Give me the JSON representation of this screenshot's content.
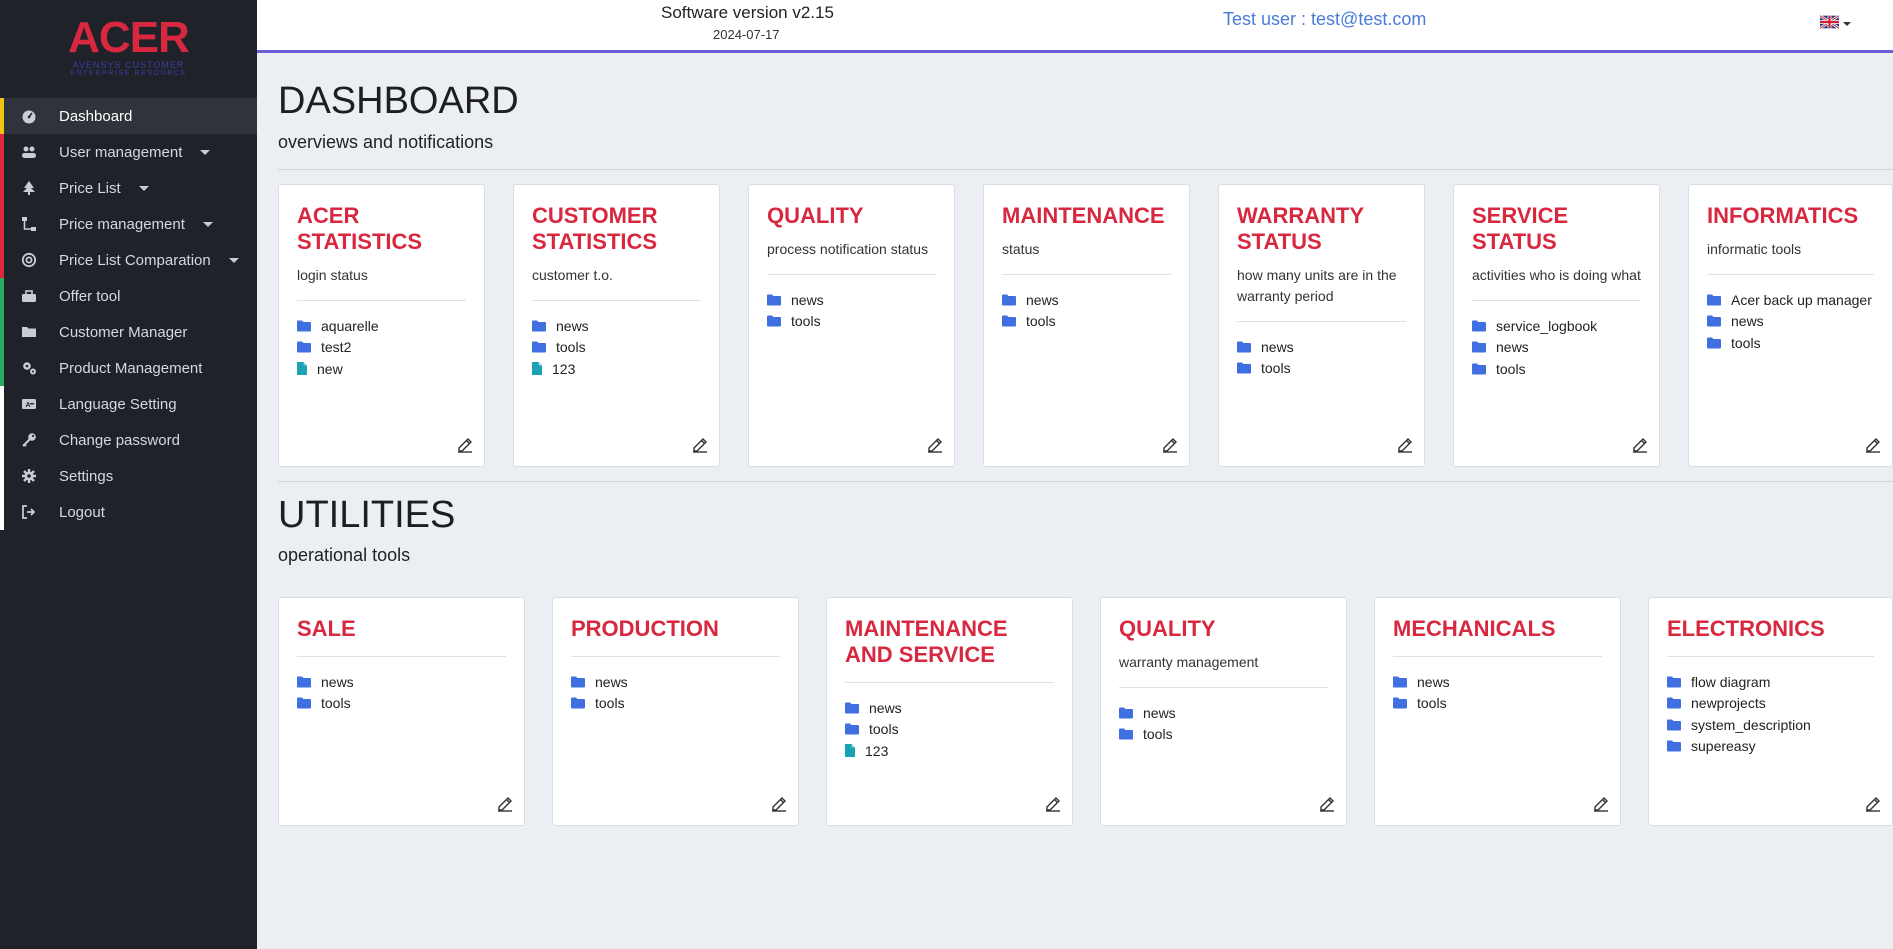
{
  "app": {
    "logo_main": "ACER",
    "logo_sub": "AVENSYS CUSTOMER",
    "logo_sub2": "ENTERPRISE RESOURCE"
  },
  "header": {
    "version": "Software version v2.15",
    "date": "2024-07-17",
    "user": "Test user : test@test.com",
    "language_icon": "uk-flag-icon"
  },
  "sidebar": {
    "items": [
      {
        "label": "Dashboard",
        "icon": "gauge-icon",
        "accent": "#f1c40f",
        "active": true
      },
      {
        "label": "User management",
        "icon": "users-icon",
        "accent": "#e0283f",
        "caret": true
      },
      {
        "label": "Price List",
        "icon": "tree-icon",
        "accent": "#e0283f",
        "caret": true
      },
      {
        "label": "Price management",
        "icon": "sitemap-icon",
        "accent": "#e0283f",
        "caret": true
      },
      {
        "label": "Price List Comparation",
        "icon": "target-icon",
        "accent": "#e0283f",
        "caret": true
      },
      {
        "label": "Offer tool",
        "icon": "toolbox-icon",
        "accent": "#27ae60"
      },
      {
        "label": "Customer Manager",
        "icon": "folder-icon",
        "accent": "#27ae60"
      },
      {
        "label": "Product Management",
        "icon": "cogs-icon",
        "accent": "#27ae60"
      },
      {
        "label": "Language Setting",
        "icon": "language-icon",
        "accent": "#ffffff"
      },
      {
        "label": "Change password",
        "icon": "key-icon",
        "accent": "#ffffff"
      },
      {
        "label": "Settings",
        "icon": "gear-icon",
        "accent": "#ffffff"
      },
      {
        "label": "Logout",
        "icon": "logout-icon",
        "accent": "#ffffff"
      }
    ]
  },
  "dashboard": {
    "title": "DASHBOARD",
    "subtitle": "overviews and notifications",
    "cards": [
      {
        "title": "ACER STATISTICS",
        "desc": "login status",
        "items": [
          {
            "label": "aquarelle",
            "type": "folder"
          },
          {
            "label": "test2",
            "type": "folder"
          },
          {
            "label": "new",
            "type": "file"
          }
        ]
      },
      {
        "title": "CUSTOMER STATISTICS",
        "desc": "customer t.o.",
        "items": [
          {
            "label": "news",
            "type": "folder"
          },
          {
            "label": "tools",
            "type": "folder"
          },
          {
            "label": "123",
            "type": "file"
          }
        ]
      },
      {
        "title": "QUALITY",
        "desc": "process notification status",
        "items": [
          {
            "label": "news",
            "type": "folder"
          },
          {
            "label": "tools",
            "type": "folder"
          }
        ]
      },
      {
        "title": "MAINTENANCE",
        "desc": "status",
        "items": [
          {
            "label": "news",
            "type": "folder"
          },
          {
            "label": "tools",
            "type": "folder"
          }
        ]
      },
      {
        "title": "WARRANTY STATUS",
        "desc": "how many units are in the warranty period",
        "items": [
          {
            "label": "news",
            "type": "folder"
          },
          {
            "label": "tools",
            "type": "folder"
          }
        ]
      },
      {
        "title": "SERVICE STATUS",
        "desc": "activities who is doing what",
        "items": [
          {
            "label": "service_logbook",
            "type": "folder"
          },
          {
            "label": "news",
            "type": "folder"
          },
          {
            "label": "tools",
            "type": "folder"
          }
        ]
      },
      {
        "title": "INFORMATICS",
        "desc": "informatic tools",
        "items": [
          {
            "label": "Acer back up manager",
            "type": "folder"
          },
          {
            "label": "news",
            "type": "folder"
          },
          {
            "label": "tools",
            "type": "folder"
          }
        ]
      }
    ]
  },
  "utilities": {
    "title": "UTILITIES",
    "subtitle": "operational tools",
    "cards": [
      {
        "title": "SALE",
        "desc": "",
        "items": [
          {
            "label": "news",
            "type": "folder"
          },
          {
            "label": "tools",
            "type": "folder"
          }
        ]
      },
      {
        "title": "PRODUCTION",
        "desc": "",
        "items": [
          {
            "label": "news",
            "type": "folder"
          },
          {
            "label": "tools",
            "type": "folder"
          }
        ]
      },
      {
        "title": "MAINTENANCE AND SERVICE",
        "desc": "",
        "items": [
          {
            "label": "news",
            "type": "folder"
          },
          {
            "label": "tools",
            "type": "folder"
          },
          {
            "label": "123",
            "type": "file"
          }
        ]
      },
      {
        "title": "QUALITY",
        "desc": "warranty management",
        "items": [
          {
            "label": "news",
            "type": "folder"
          },
          {
            "label": "tools",
            "type": "folder"
          }
        ]
      },
      {
        "title": "MECHANICALS",
        "desc": "",
        "items": [
          {
            "label": "news",
            "type": "folder"
          },
          {
            "label": "tools",
            "type": "folder"
          }
        ]
      },
      {
        "title": "ELECTRONICS",
        "desc": "",
        "items": [
          {
            "label": "flow diagram",
            "type": "folder"
          },
          {
            "label": "newprojects",
            "type": "folder"
          },
          {
            "label": "system_description",
            "type": "folder"
          },
          {
            "label": "supereasy",
            "type": "folder"
          }
        ]
      }
    ]
  },
  "colors": {
    "accent_red": "#d8283f",
    "folder_blue": "#3f6fe0",
    "file_teal": "#1aa3b5",
    "header_border": "#6a5fd6"
  }
}
